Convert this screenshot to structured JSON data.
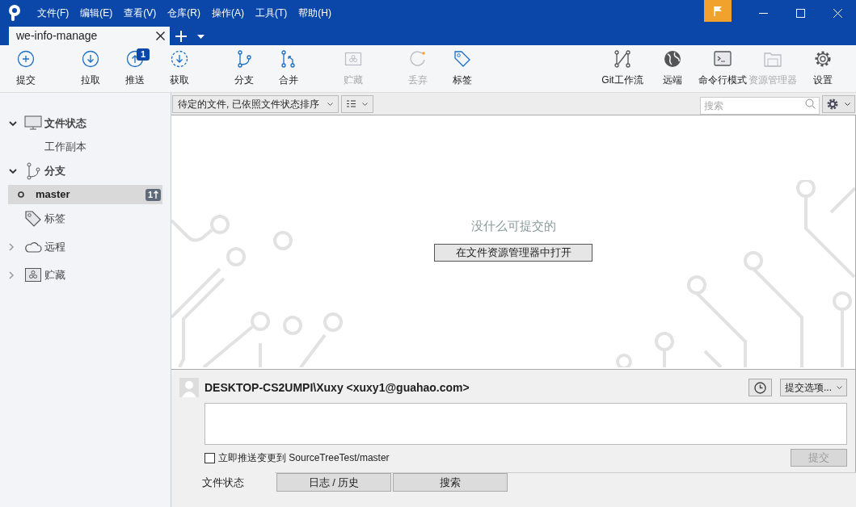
{
  "menu": [
    "文件(F)",
    "编辑(E)",
    "查看(V)",
    "仓库(R)",
    "操作(A)",
    "工具(T)",
    "帮助(H)"
  ],
  "repo_tabs": [
    {
      "label": "we-info-manage",
      "selected": true
    }
  ],
  "toolbar_left": [
    {
      "label": "提交",
      "disabled": false
    },
    {
      "label": "拉取",
      "disabled": false
    },
    {
      "label": "推送",
      "disabled": false,
      "badge": "1"
    },
    {
      "label": "获取",
      "disabled": false
    },
    {
      "label": "分支",
      "disabled": false
    },
    {
      "label": "合并",
      "disabled": false
    },
    {
      "label": "贮藏",
      "disabled": true
    },
    {
      "label": "丢弃",
      "disabled": true
    },
    {
      "label": "标签",
      "disabled": false
    }
  ],
  "toolbar_right": [
    {
      "label": "Git工作流",
      "disabled": false
    },
    {
      "label": "远端",
      "disabled": false
    },
    {
      "label": "命令行模式",
      "disabled": false
    },
    {
      "label": "资源管理器",
      "disabled": true
    },
    {
      "label": "设置",
      "disabled": false
    }
  ],
  "sidebar": [
    {
      "label": "文件状态",
      "kind": "group",
      "expanded": true,
      "children": [
        {
          "label": "工作副本",
          "selected": false
        }
      ]
    },
    {
      "label": "分支",
      "kind": "group",
      "expanded": true,
      "children": [
        {
          "label": "master",
          "selected": true,
          "badge": "1"
        }
      ]
    },
    {
      "label": "标签",
      "kind": "plain"
    },
    {
      "label": "远程",
      "kind": "group",
      "expanded": false
    },
    {
      "label": "贮藏",
      "kind": "group",
      "expanded": false
    }
  ],
  "filter_bar": {
    "sort_dropdown": "待定的文件, 已依照文件状态排序",
    "search": {
      "placeholder": "搜索"
    }
  },
  "empty_state": {
    "message": "没什么可提交的",
    "button": "在文件资源管理器中打开"
  },
  "commit_panel": {
    "author": "DESKTOP-CS2UMPI\\Xuxy <xuxy1@guahao.com>",
    "options_dropdown": "提交选项...",
    "push_checkbox": {
      "label": "立即推送变更到 SourceTreeTest/master",
      "checked": false
    },
    "commit_button": {
      "label": "提交",
      "disabled": true
    }
  },
  "bottom_tabs": [
    {
      "label": "文件状态",
      "selected": true
    },
    {
      "label": "日志 / 历史",
      "selected": false
    },
    {
      "label": "搜索",
      "selected": false
    }
  ]
}
